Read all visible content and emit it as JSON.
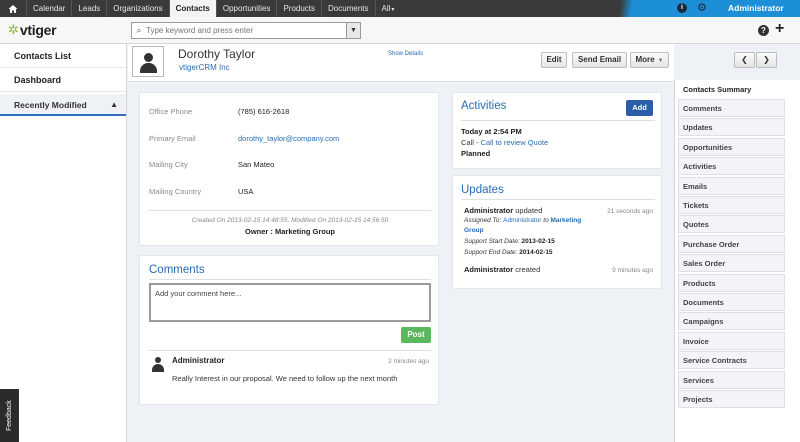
{
  "topnav": {
    "items": [
      "Calendar",
      "Leads",
      "Organizations",
      "Contacts",
      "Opportunities",
      "Products",
      "Documents",
      "All"
    ],
    "all_caret": "▾",
    "user": "Administrator"
  },
  "header": {
    "logo_mark": "✲",
    "logo_text": "vtiger",
    "search_placeholder": "Type keyword and press enter"
  },
  "sidebar": {
    "items": [
      "Contacts List",
      "Dashboard"
    ],
    "recent_label": "Recently Modified",
    "feedback": "Feedback"
  },
  "record": {
    "name": "Dorothy Taylor",
    "organization": "vtigerCRM Inc",
    "show_details": "Show Details",
    "buttons": {
      "edit": "Edit",
      "send_email": "Send Email",
      "more": "More"
    }
  },
  "details": {
    "fields": [
      {
        "label": "Office Phone",
        "value": "(785) 616-2618"
      },
      {
        "label": "Primary Email",
        "value": "dorothy_taylor@company.com"
      },
      {
        "label": "Mailing City",
        "value": "San Mateo"
      },
      {
        "label": "Mailing Country",
        "value": "USA"
      }
    ],
    "meta": "Created On 2013-02-15 14:48:55,  Modified On 2013-02-15 14:56:50",
    "owner": "Owner : Marketing Group"
  },
  "comments": {
    "title": "Comments",
    "placeholder": "Add your comment here...",
    "post_label": "Post",
    "items": [
      {
        "author": "Administrator",
        "time": "2 minutes ago",
        "text": "Really Interest in our proposal. We need to follow up the next month"
      }
    ]
  },
  "activities": {
    "title": "Activities",
    "add_label": "Add",
    "when": "Today at 2:54 PM",
    "type": "Call - ",
    "subject": "Call to review Quote",
    "status": "Planned"
  },
  "updates": {
    "title": "Updates",
    "first": {
      "who": "Administrator",
      "action": " updated",
      "time": "21 seconds ago",
      "assigned_label": "Assigned To: ",
      "assigned_from": "Administrator",
      "assigned_mid": " to ",
      "assigned_to_1": "Marketing",
      "assigned_to_2": "Group",
      "start_label": "Support Start Date: ",
      "start_value": "2013-02-15",
      "end_label": "Support End Date: ",
      "end_value": "2014-02-15"
    },
    "second": {
      "who": "Administrator",
      "action": " created",
      "time": "9 minutes ago"
    }
  },
  "summary_nav": [
    "Contacts Summary",
    "Comments",
    "Updates",
    "Opportunities",
    "Activities",
    "Emails",
    "Tickets",
    "Quotes",
    "Purchase Order",
    "Sales Order",
    "Products",
    "Documents",
    "Campaigns",
    "Invoice",
    "Service Contracts",
    "Services",
    "Projects"
  ]
}
